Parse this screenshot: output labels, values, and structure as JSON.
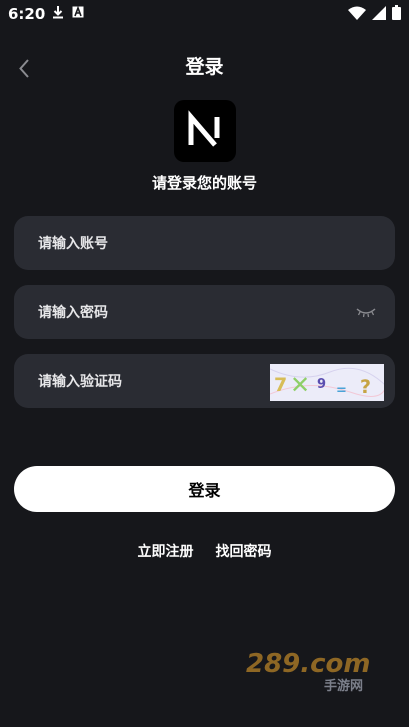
{
  "status_bar": {
    "time": "6:20",
    "left_icons": [
      "download-icon",
      "app-badge-icon"
    ],
    "right_icons": [
      "wifi-icon",
      "cellular-icon",
      "battery-icon"
    ]
  },
  "header": {
    "title": "登录",
    "back_icon": "chevron-left-icon"
  },
  "logo": {
    "letter": "N",
    "background": "#000000"
  },
  "subtitle": "请登录您的账号",
  "form": {
    "account": {
      "placeholder": "请输入账号",
      "value": ""
    },
    "password": {
      "placeholder": "请输入密码",
      "value": "",
      "toggle_icon": "eye-closed-icon"
    },
    "captcha": {
      "placeholder": "请输入验证码",
      "value": "",
      "image_text": [
        "7",
        "✕",
        "9",
        "=",
        "?"
      ]
    }
  },
  "buttons": {
    "login": "登录"
  },
  "links": {
    "register": "立即注册",
    "forgot_password": "找回密码"
  },
  "watermark": {
    "brand": "289.com",
    "subtext": "手游网"
  },
  "colors": {
    "background": "#16171b",
    "field": "#2a2c33",
    "button": "#ffffff",
    "captcha_bg": "#ececf9"
  }
}
